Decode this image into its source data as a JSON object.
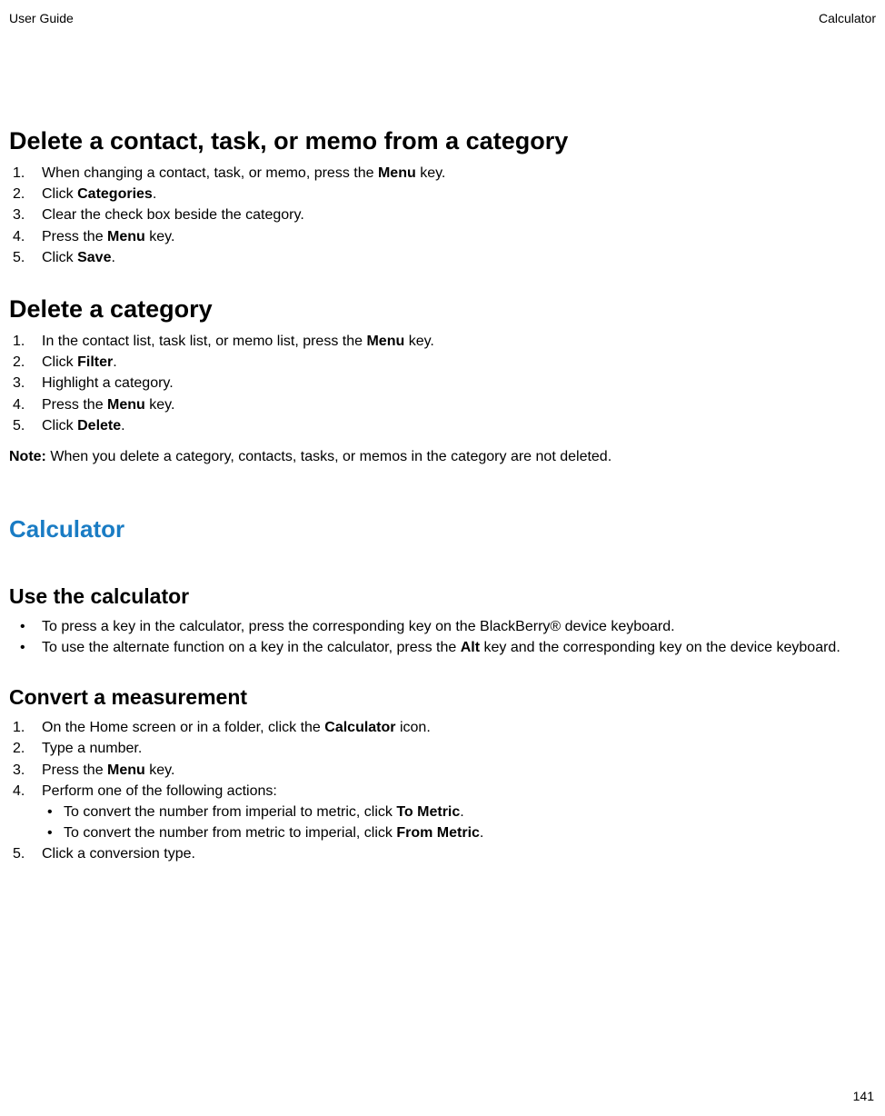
{
  "header": {
    "left": "User Guide",
    "right": "Calculator"
  },
  "page_number": "141",
  "sections": {
    "delete_from_category": {
      "title": "Delete a contact, task, or memo from a category",
      "steps": {
        "s1a": "When changing a contact, task, or memo, press the ",
        "s1b": "Menu",
        "s1c": " key.",
        "s2a": "Click ",
        "s2b": "Categories",
        "s2c": ".",
        "s3": "Clear the check box beside the category.",
        "s4a": "Press the ",
        "s4b": "Menu",
        "s4c": " key.",
        "s5a": "Click ",
        "s5b": "Save",
        "s5c": "."
      }
    },
    "delete_category": {
      "title": "Delete a category",
      "steps": {
        "s1a": "In the contact list, task list, or memo list, press the ",
        "s1b": "Menu",
        "s1c": " key.",
        "s2a": "Click ",
        "s2b": "Filter",
        "s2c": ".",
        "s3": "Highlight a category.",
        "s4a": "Press the ",
        "s4b": "Menu",
        "s4c": " key.",
        "s5a": "Click ",
        "s5b": "Delete",
        "s5c": "."
      },
      "note_label": "Note:",
      "note_text": "  When you delete a category, contacts, tasks, or memos in the category are not deleted."
    },
    "calculator_heading": "Calculator",
    "use_calculator": {
      "title": "Use the calculator",
      "items": {
        "i1": "To press a key in the calculator, press the corresponding key on the BlackBerry® device keyboard.",
        "i2a": "To use the alternate function on a key in the calculator, press the ",
        "i2b": "Alt",
        "i2c": " key and the corresponding key on the device keyboard."
      }
    },
    "convert": {
      "title": "Convert a measurement",
      "steps": {
        "s1a": "On the Home screen or in a folder, click the ",
        "s1b": "Calculator",
        "s1c": " icon.",
        "s2": "Type a number.",
        "s3a": "Press the ",
        "s3b": "Menu",
        "s3c": " key.",
        "s4": "Perform one of the following actions:",
        "s4_i1a": "To convert the number from imperial to metric, click ",
        "s4_i1b": "To Metric",
        "s4_i1c": ".",
        "s4_i2a": "To convert the number from metric to imperial, click ",
        "s4_i2b": "From Metric",
        "s4_i2c": ".",
        "s5": "Click a conversion type."
      }
    }
  }
}
